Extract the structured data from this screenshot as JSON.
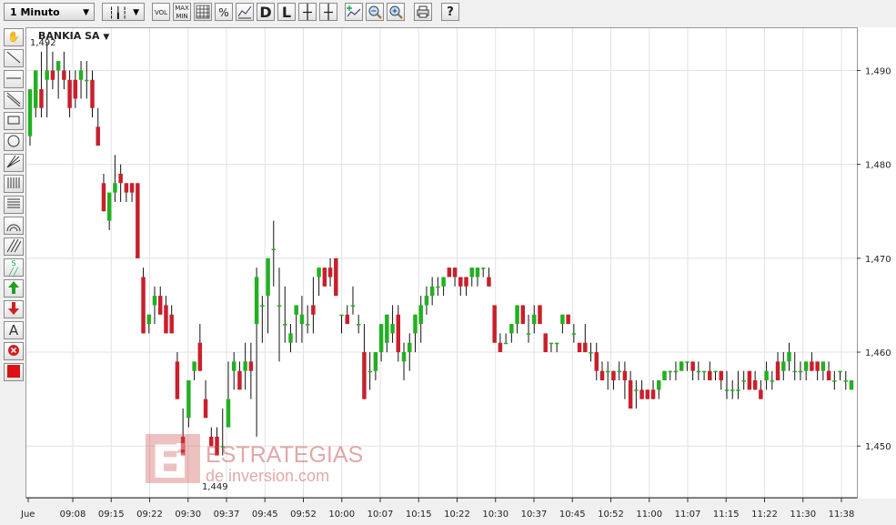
{
  "toolbar": {
    "period": "1 Minuto",
    "buttons": [
      "VOL",
      "MAX MIN",
      "%",
      "D",
      "L",
      "?"
    ]
  },
  "chart_title": "BANKIA SA",
  "high_label": "1,492",
  "low_label": "1,449",
  "watermark": {
    "line1": "ESTRATEGIAS",
    "line2": "de inversion.com"
  },
  "colors": {
    "up": "#22b022",
    "down": "#c8202c",
    "grid": "#e2e2e2"
  },
  "chart_data": {
    "type": "candlestick",
    "title": "BANKIA SA",
    "y_ticks": [
      "1,450",
      "1,460",
      "1,470",
      "1,480",
      "1,490"
    ],
    "ylim": [
      1.4445,
      1.4945
    ],
    "x_tick_labels": [
      "Jue",
      "09:08",
      "09:15",
      "09:22",
      "09:30",
      "09:37",
      "09:45",
      "09:52",
      "10:00",
      "10:07",
      "10:15",
      "10:22",
      "10:30",
      "10:37",
      "10:45",
      "10:52",
      "11:00",
      "11:07",
      "11:15",
      "11:22",
      "11:30",
      "11:38"
    ],
    "grid": true,
    "candles": [
      [
        1.483,
        1.488,
        1.482,
        1.488
      ],
      [
        1.486,
        1.49,
        1.485,
        1.49
      ],
      [
        1.488,
        1.492,
        1.485,
        1.486
      ],
      [
        1.489,
        1.493,
        1.485,
        1.49
      ],
      [
        1.49,
        1.492,
        1.488,
        1.489
      ],
      [
        1.49,
        1.491,
        1.487,
        1.491
      ],
      [
        1.49,
        1.492,
        1.488,
        1.489
      ],
      [
        1.489,
        1.49,
        1.485,
        1.486
      ],
      [
        1.489,
        1.49,
        1.486,
        1.487
      ],
      [
        1.489,
        1.491,
        1.487,
        1.49
      ],
      [
        1.489,
        1.491,
        1.487,
        1.489
      ],
      [
        1.489,
        1.49,
        1.485,
        1.486
      ],
      [
        1.484,
        1.486,
        1.482,
        1.482
      ],
      [
        1.478,
        1.479,
        1.475,
        1.475
      ],
      [
        1.474,
        1.477,
        1.473,
        1.477
      ],
      [
        1.477,
        1.481,
        1.476,
        1.478
      ],
      [
        1.479,
        1.48,
        1.476,
        1.478
      ],
      [
        1.478,
        1.478,
        1.476,
        1.477
      ],
      [
        1.478,
        1.478,
        1.476,
        1.477
      ],
      [
        1.478,
        1.478,
        1.47,
        1.47
      ],
      [
        1.468,
        1.469,
        1.462,
        1.462
      ],
      [
        1.463,
        1.464,
        1.462,
        1.464
      ],
      [
        1.465,
        1.467,
        1.463,
        1.466
      ],
      [
        1.466,
        1.467,
        1.464,
        1.464
      ],
      [
        1.465,
        1.466,
        1.462,
        1.462
      ],
      [
        1.464,
        1.465,
        1.462,
        1.462
      ],
      [
        1.459,
        1.46,
        1.455,
        1.455
      ],
      [
        1.451,
        1.454,
        1.449,
        1.449
      ],
      [
        1.453,
        1.457,
        1.452,
        1.457
      ],
      [
        1.458,
        1.459,
        1.457,
        1.459
      ],
      [
        1.461,
        1.463,
        1.458,
        1.458
      ],
      [
        1.455,
        1.457,
        1.453,
        1.453
      ],
      [
        1.451,
        1.452,
        1.45,
        1.45
      ],
      [
        1.451,
        1.452,
        1.449,
        1.449
      ],
      [
        1.45,
        1.454,
        1.449,
        1.45
      ],
      [
        1.452,
        1.459,
        1.452,
        1.455
      ],
      [
        1.458,
        1.46,
        1.456,
        1.459
      ],
      [
        1.458,
        1.459,
        1.456,
        1.456
      ],
      [
        1.458,
        1.461,
        1.456,
        1.459
      ],
      [
        1.459,
        1.461,
        1.455,
        1.458
      ],
      [
        1.463,
        1.469,
        1.451,
        1.468
      ],
      [
        1.465,
        1.466,
        1.461,
        1.465
      ],
      [
        1.466,
        1.47,
        1.462,
        1.47
      ],
      [
        1.471,
        1.474,
        1.467,
        1.471
      ],
      [
        1.465,
        1.469,
        1.459,
        1.465
      ],
      [
        1.463,
        1.467,
        1.461,
        1.463
      ],
      [
        1.461,
        1.463,
        1.46,
        1.462
      ],
      [
        1.464,
        1.465,
        1.461,
        1.465
      ],
      [
        1.463,
        1.466,
        1.461,
        1.464
      ],
      [
        1.463,
        1.465,
        1.462,
        1.463
      ],
      [
        1.465,
        1.468,
        1.462,
        1.464
      ],
      [
        1.468,
        1.469,
        1.466,
        1.469
      ],
      [
        1.469,
        1.469,
        1.467,
        1.467
      ],
      [
        1.469,
        1.47,
        1.467,
        1.468
      ],
      [
        1.47,
        1.47,
        1.466,
        1.466
      ],
      [
        1.464,
        1.464,
        1.462,
        1.464
      ],
      [
        1.464,
        1.465,
        1.463,
        1.463
      ],
      [
        1.465,
        1.467,
        1.464,
        1.465
      ],
      [
        1.463,
        1.464,
        1.462,
        1.463
      ],
      [
        1.46,
        1.463,
        1.455,
        1.455
      ],
      [
        1.458,
        1.46,
        1.456,
        1.458
      ],
      [
        1.458,
        1.46,
        1.457,
        1.46
      ],
      [
        1.46,
        1.462,
        1.459,
        1.463
      ],
      [
        1.461,
        1.464,
        1.46,
        1.464
      ],
      [
        1.462,
        1.465,
        1.461,
        1.463
      ],
      [
        1.464,
        1.465,
        1.459,
        1.46
      ],
      [
        1.459,
        1.461,
        1.457,
        1.46
      ],
      [
        1.46,
        1.462,
        1.458,
        1.461
      ],
      [
        1.462,
        1.464,
        1.46,
        1.464
      ],
      [
        1.463,
        1.466,
        1.461,
        1.465
      ],
      [
        1.465,
        1.467,
        1.464,
        1.466
      ],
      [
        1.466,
        1.468,
        1.465,
        1.467
      ],
      [
        1.467,
        1.468,
        1.466,
        1.467
      ],
      [
        1.467,
        1.468,
        1.466,
        1.468
      ],
      [
        1.469,
        1.469,
        1.468,
        1.468
      ],
      [
        1.469,
        1.469,
        1.467,
        1.468
      ],
      [
        1.468,
        1.468,
        1.466,
        1.467
      ],
      [
        1.468,
        1.468,
        1.466,
        1.467
      ],
      [
        1.468,
        1.469,
        1.467,
        1.469
      ],
      [
        1.468,
        1.469,
        1.467,
        1.469
      ],
      [
        1.469,
        1.469,
        1.468,
        1.469
      ],
      [
        1.468,
        1.469,
        1.467,
        1.467
      ],
      [
        1.465,
        1.465,
        1.461,
        1.461
      ],
      [
        1.461,
        1.462,
        1.46,
        1.46
      ],
      [
        1.461,
        1.462,
        1.461,
        1.461
      ],
      [
        1.462,
        1.463,
        1.461,
        1.463
      ],
      [
        1.463,
        1.465,
        1.462,
        1.465
      ],
      [
        1.465,
        1.465,
        1.463,
        1.463
      ],
      [
        1.462,
        1.464,
        1.461,
        1.462
      ],
      [
        1.463,
        1.465,
        1.462,
        1.464
      ],
      [
        1.465,
        1.465,
        1.463,
        1.463
      ],
      [
        1.462,
        1.462,
        1.46,
        1.46
      ],
      [
        1.461,
        1.461,
        1.46,
        1.461
      ],
      [
        1.461,
        1.461,
        1.46,
        1.461
      ],
      [
        1.463,
        1.464,
        1.462,
        1.464
      ],
      [
        1.464,
        1.464,
        1.463,
        1.463
      ],
      [
        1.462,
        1.463,
        1.461,
        1.462
      ],
      [
        1.461,
        1.461,
        1.46,
        1.46
      ],
      [
        1.461,
        1.463,
        1.46,
        1.46
      ],
      [
        1.46,
        1.461,
        1.459,
        1.46
      ],
      [
        1.46,
        1.461,
        1.457,
        1.458
      ],
      [
        1.458,
        1.459,
        1.457,
        1.457
      ],
      [
        1.458,
        1.459,
        1.456,
        1.458
      ],
      [
        1.458,
        1.458,
        1.456,
        1.457
      ],
      [
        1.458,
        1.459,
        1.457,
        1.458
      ],
      [
        1.458,
        1.459,
        1.455,
        1.457
      ],
      [
        1.457,
        1.458,
        1.454,
        1.454
      ],
      [
        1.456,
        1.457,
        1.454,
        1.456
      ],
      [
        1.456,
        1.457,
        1.455,
        1.455
      ],
      [
        1.456,
        1.456,
        1.455,
        1.455
      ],
      [
        1.456,
        1.457,
        1.455,
        1.455
      ],
      [
        1.456,
        1.457,
        1.455,
        1.457
      ],
      [
        1.457,
        1.458,
        1.457,
        1.458
      ],
      [
        1.458,
        1.458,
        1.457,
        1.458
      ],
      [
        1.458,
        1.459,
        1.457,
        1.458
      ],
      [
        1.458,
        1.459,
        1.458,
        1.459
      ],
      [
        1.459,
        1.459,
        1.458,
        1.459
      ],
      [
        1.459,
        1.459,
        1.457,
        1.458
      ],
      [
        1.458,
        1.459,
        1.457,
        1.458
      ],
      [
        1.458,
        1.458,
        1.457,
        1.458
      ],
      [
        1.458,
        1.459,
        1.457,
        1.457
      ],
      [
        1.458,
        1.458,
        1.457,
        1.458
      ],
      [
        1.458,
        1.458,
        1.456,
        1.457
      ],
      [
        1.456,
        1.458,
        1.455,
        1.456
      ],
      [
        1.456,
        1.457,
        1.455,
        1.456
      ],
      [
        1.456,
        1.458,
        1.455,
        1.456
      ],
      [
        1.457,
        1.458,
        1.456,
        1.457
      ],
      [
        1.458,
        1.458,
        1.456,
        1.456
      ],
      [
        1.457,
        1.458,
        1.456,
        1.456
      ],
      [
        1.456,
        1.457,
        1.455,
        1.455
      ],
      [
        1.457,
        1.459,
        1.456,
        1.458
      ],
      [
        1.457,
        1.458,
        1.456,
        1.457
      ],
      [
        1.459,
        1.46,
        1.457,
        1.457
      ],
      [
        1.458,
        1.46,
        1.457,
        1.459
      ],
      [
        1.459,
        1.461,
        1.458,
        1.46
      ],
      [
        1.458,
        1.46,
        1.457,
        1.458
      ],
      [
        1.458,
        1.459,
        1.457,
        1.458
      ],
      [
        1.458,
        1.459,
        1.457,
        1.459
      ],
      [
        1.459,
        1.46,
        1.458,
        1.458
      ],
      [
        1.459,
        1.459,
        1.457,
        1.458
      ],
      [
        1.458,
        1.459,
        1.457,
        1.459
      ],
      [
        1.458,
        1.459,
        1.457,
        1.457
      ],
      [
        1.457,
        1.458,
        1.456,
        1.457
      ],
      [
        1.458,
        1.458,
        1.457,
        1.458
      ],
      [
        1.457,
        1.458,
        1.456,
        1.457
      ],
      [
        1.456,
        1.457,
        1.456,
        1.457
      ]
    ]
  }
}
